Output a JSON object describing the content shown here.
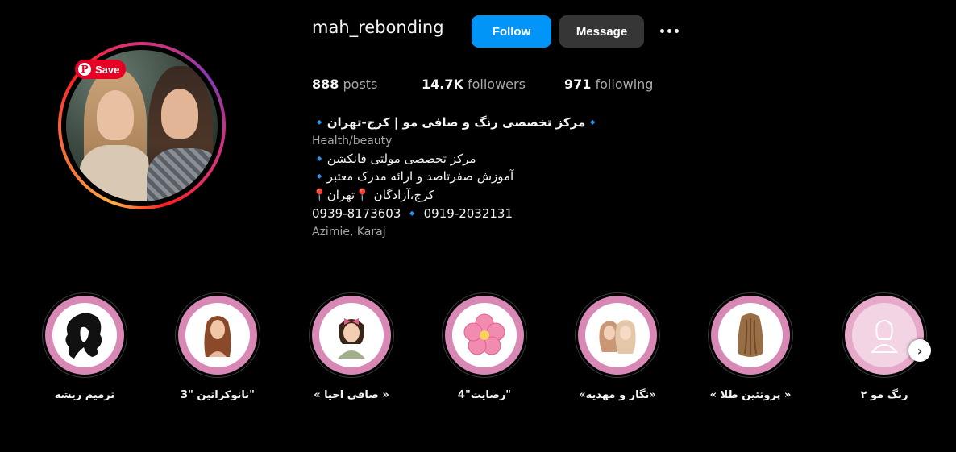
{
  "save_badge": {
    "label": "Save",
    "icon": "pinterest-icon"
  },
  "header": {
    "username": "mah_rebonding",
    "follow_label": "Follow",
    "message_label": "Message",
    "more_icon": "more-options-icon"
  },
  "stats": {
    "posts_count": "888",
    "posts_label": "posts",
    "followers_count": "14.7K",
    "followers_label": "followers",
    "following_count": "971",
    "following_label": "following"
  },
  "bio": {
    "name": "🔹مرکز تخصصی رنگ و صافی مو | کرج-تهران🔹",
    "category": "Health/beauty",
    "line1": "🔹مرکز تخصصی مولتی فانکشن",
    "line2": "🔹آموزش صفرتاصد و ارائه مدرک معتبر",
    "line3": "📍کرج،آزادگان 📍تهران",
    "line4": "0939-8173603 🔹 0919-2032131",
    "location": "Azimie, Karaj"
  },
  "highlights": [
    {
      "label": "ترمیم ریشه",
      "icon": "hair-silhouette-icon"
    },
    {
      "label": "نانوکراتین \"3\"",
      "icon": "woman-long-hair-icon"
    },
    {
      "label": "« صافی احیا »",
      "icon": "woman-bow-icon"
    },
    {
      "label": "رضایت\"4\"",
      "icon": "pink-flower-icon"
    },
    {
      "label": "«نگار و مهدیه»",
      "icon": "two-women-icon"
    },
    {
      "label": "« پروتئین طلا »",
      "icon": "hair-back-icon"
    },
    {
      "label": "رنگ مو ۲",
      "icon": "woman-outline-icon"
    }
  ],
  "next_icon": "chevron-right-icon",
  "colors": {
    "background": "#000000",
    "follow_button": "#0095f6",
    "message_button": "#363636",
    "highlight_pink": "#d888b4",
    "save_badge": "#e60023"
  }
}
